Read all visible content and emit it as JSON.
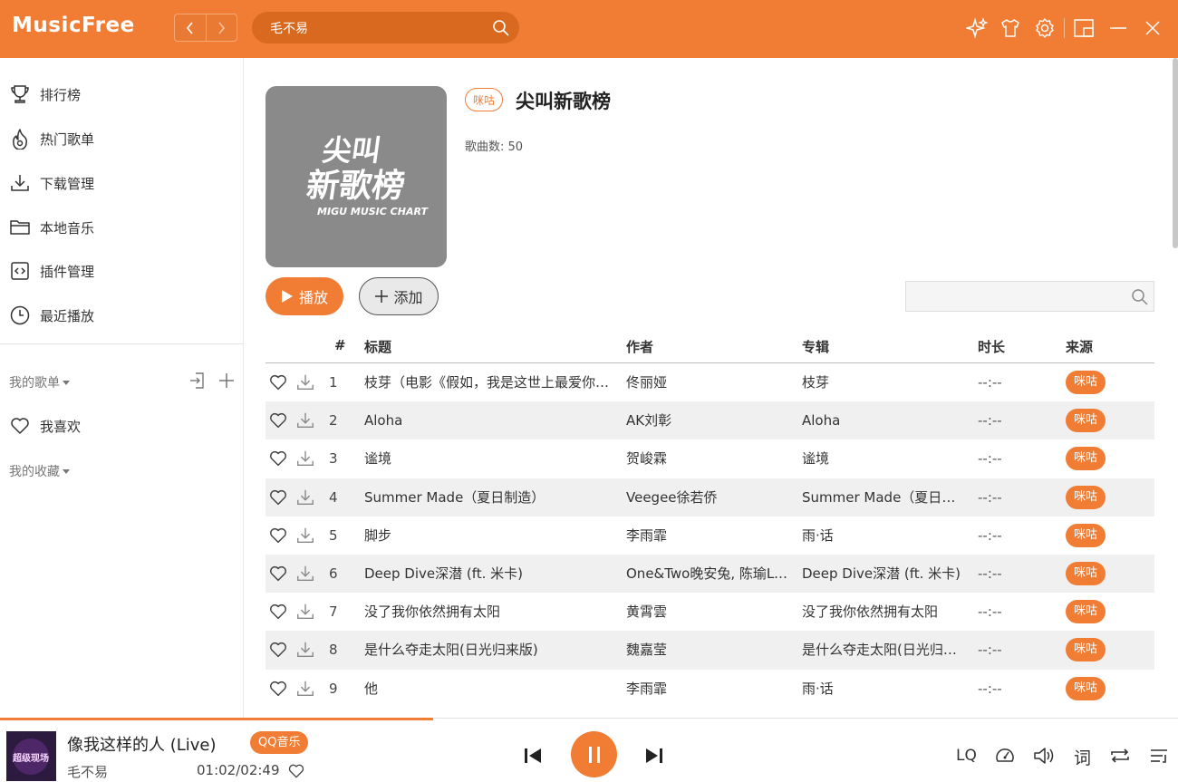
{
  "app": {
    "name": "MusicFree"
  },
  "search": {
    "value": "毛不易"
  },
  "sidebar": {
    "items": [
      {
        "label": "排行榜"
      },
      {
        "label": "热门歌单"
      },
      {
        "label": "下载管理"
      },
      {
        "label": "本地音乐"
      },
      {
        "label": "插件管理"
      },
      {
        "label": "最近播放"
      }
    ],
    "my_sheets_label": "我的歌单",
    "favorite_label": "我喜欢",
    "my_collections_label": "我的收藏"
  },
  "sheet": {
    "cover_text_line1": "尖叫",
    "cover_text_line2": "新歌榜",
    "cover_text_line3": "MIGU MUSIC CHART",
    "source": "咪咕",
    "title": "尖叫新歌榜",
    "count_label": "歌曲数: 50",
    "play_label": "播放",
    "add_label": "添加",
    "filter_placeholder": ""
  },
  "table": {
    "headers": {
      "index": "#",
      "title": "标题",
      "artist": "作者",
      "album": "专辑",
      "duration": "时长",
      "source": "来源"
    },
    "rows": [
      {
        "index": "1",
        "title": "枝芽（电影《假如，我是这世上最爱你的人》主题曲）",
        "artist": "佟丽娅",
        "album": "枝芽",
        "duration": "--:--",
        "source": "咪咕"
      },
      {
        "index": "2",
        "title": "Aloha",
        "artist": "AK刘彰",
        "album": "Aloha",
        "duration": "--:--",
        "source": "咪咕"
      },
      {
        "index": "3",
        "title": "谧境",
        "artist": "贺峻霖",
        "album": "谧境",
        "duration": "--:--",
        "source": "咪咕"
      },
      {
        "index": "4",
        "title": "Summer Made（夏日制造）",
        "artist": "Veegee徐若侨",
        "album": "Summer Made（夏日制造）",
        "duration": "--:--",
        "source": "咪咕"
      },
      {
        "index": "5",
        "title": "脚步",
        "artist": "李雨霏",
        "album": "雨·话",
        "duration": "--:--",
        "source": "咪咕"
      },
      {
        "index": "6",
        "title": "Deep Dive深潜 (ft. 米卡)",
        "artist": "One&Two晚安兔, 陈瑜LeleChen",
        "album": "Deep Dive深潜 (ft. 米卡)",
        "duration": "--:--",
        "source": "咪咕"
      },
      {
        "index": "7",
        "title": "没了我你依然拥有太阳",
        "artist": "黄霄雲",
        "album": "没了我你依然拥有太阳",
        "duration": "--:--",
        "source": "咪咕"
      },
      {
        "index": "8",
        "title": "是什么夺走太阳(日光归来版)",
        "artist": "魏嘉莹",
        "album": "是什么夺走太阳(日光归来版)",
        "duration": "--:--",
        "source": "咪咕"
      },
      {
        "index": "9",
        "title": "他",
        "artist": "李雨霏",
        "album": "雨·话",
        "duration": "--:--",
        "source": "咪咕"
      }
    ]
  },
  "player": {
    "title": "像我这样的人 (Live)",
    "artist": "毛不易",
    "source": "QQ音乐",
    "time": "01:02/02:49",
    "progress": 0.368,
    "quality": "LQ",
    "lyric_label": "词",
    "cover_text": "超级现场"
  },
  "colors": {
    "accent": "#f17d34",
    "header_bg": "#f17d34",
    "row_alt": "#f0f0f0"
  }
}
